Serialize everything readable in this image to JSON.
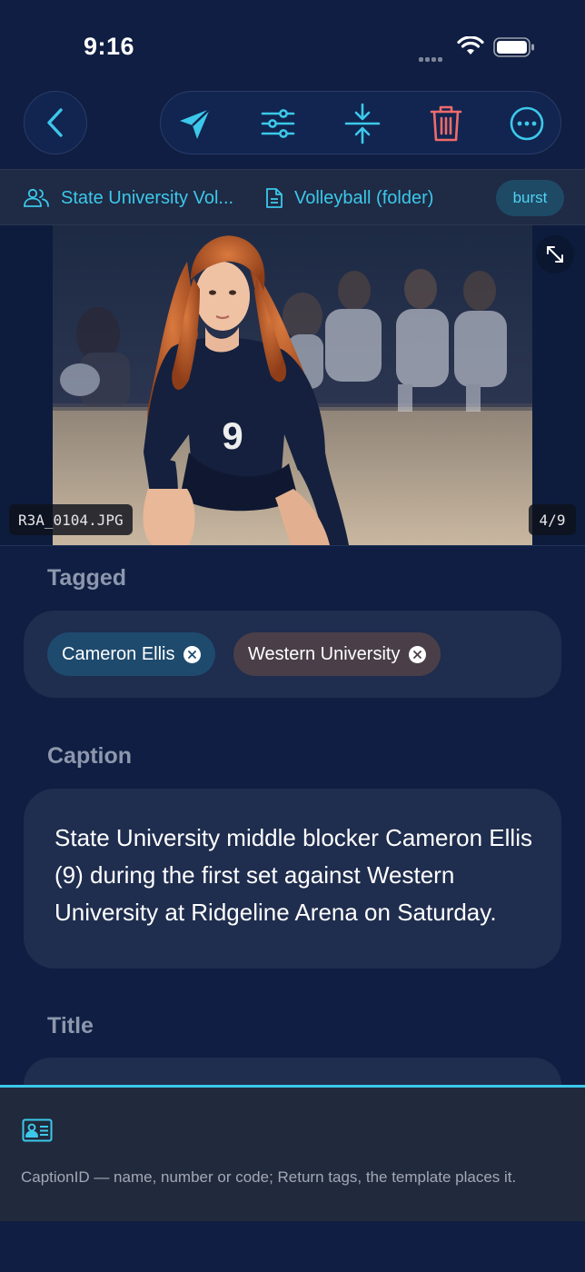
{
  "status_bar": {
    "time": "9:16"
  },
  "toolbar": {
    "back_icon": "chevron-left-icon",
    "actions": [
      "send-icon",
      "sliders-icon",
      "merge-icon",
      "trash-icon",
      "more-icon"
    ]
  },
  "breadcrumb": {
    "team_label": "State University Vol...",
    "folder_label": "Volleyball (folder)",
    "badge": "burst"
  },
  "photo": {
    "filename": "R3A_0104.JPG",
    "counter": "4/9",
    "jersey_number": "9"
  },
  "tagged": {
    "label": "Tagged",
    "tags": [
      {
        "name": "Cameron Ellis",
        "color": "#1e4a6e"
      },
      {
        "name": "Western University",
        "color": "#4a3f48"
      }
    ]
  },
  "caption": {
    "label": "Caption",
    "text": "State University middle blocker Cameron Ellis (9) during the first set against Western University at Ridgeline Arena on Saturday."
  },
  "title": {
    "label": "Title"
  },
  "bottom_panel": {
    "hint": "CaptionID — name, number or code; Return tags, the template places it."
  },
  "colors": {
    "accent": "#3cc8ea",
    "danger": "#ef6b6b",
    "background": "#0f1e42",
    "card": "#1f2d4e"
  }
}
